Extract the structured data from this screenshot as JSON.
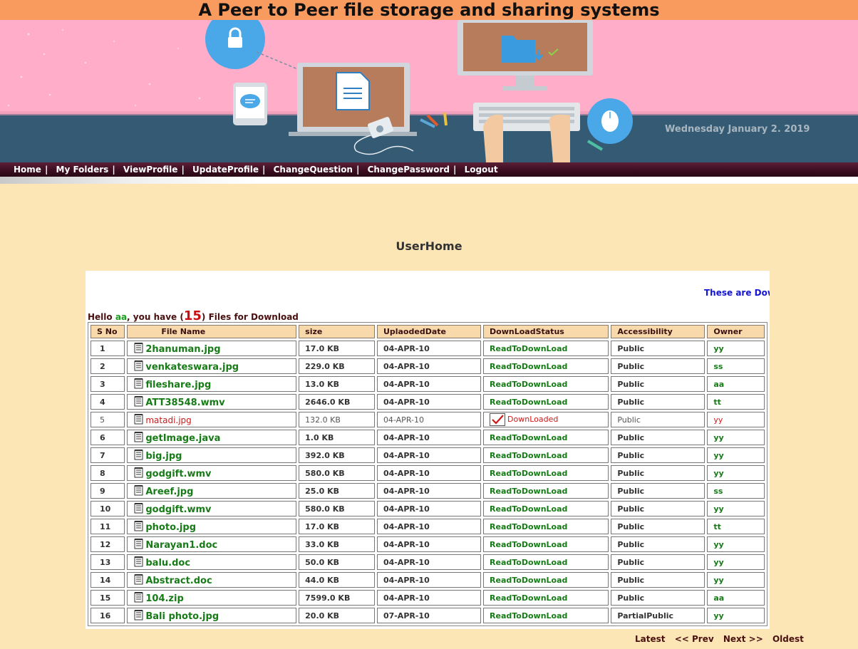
{
  "site_title": "A Peer to Peer file storage and sharing systems",
  "banner": {
    "date_text": "Wednesday January 2. 2019",
    "colors": {
      "wall": "#ffadc9",
      "desk": "#355a74",
      "screen": "#b77c5b"
    },
    "icons": [
      "lock-icon",
      "chat-icon",
      "document-icon",
      "folder-icon",
      "mouse-icon",
      "keyboard-icon",
      "music-player-icon"
    ]
  },
  "nav": {
    "items": [
      {
        "label": "Home"
      },
      {
        "label": "My Folders"
      },
      {
        "label": "ViewProfile"
      },
      {
        "label": "UpdateProfile"
      },
      {
        "label": "ChangeQuestion"
      },
      {
        "label": "ChangePassword"
      },
      {
        "label": "Logout"
      }
    ],
    "separator": "|"
  },
  "page_heading": "UserHome",
  "marquee_text": "These are Dow",
  "greeting": {
    "prefix": "Hello ",
    "username": "aa",
    "middle": ", you have (",
    "count": "15",
    "suffix": ") Files for Download"
  },
  "table": {
    "headers": {
      "sno": "S No",
      "file_name": "File Name",
      "size": "size",
      "date": "UplaodedDate",
      "status": "DownLoadStatus",
      "access": "Accessibility",
      "owner": "Owner"
    },
    "rows": [
      {
        "sno": "1",
        "name": "2hanuman.jpg",
        "size": "17.0 KB",
        "date": "04-APR-10",
        "status": "ReadToDownLoad",
        "access": "Public",
        "owner": "yy",
        "downloaded": false
      },
      {
        "sno": "2",
        "name": "venkateswara.jpg",
        "size": "229.0 KB",
        "date": "04-APR-10",
        "status": "ReadToDownLoad",
        "access": "Public",
        "owner": "ss",
        "downloaded": false
      },
      {
        "sno": "3",
        "name": "fileshare.jpg",
        "size": "13.0 KB",
        "date": "04-APR-10",
        "status": "ReadToDownLoad",
        "access": "Public",
        "owner": "aa",
        "downloaded": false
      },
      {
        "sno": "4",
        "name": "ATT38548.wmv",
        "size": "2646.0 KB",
        "date": "04-APR-10",
        "status": "ReadToDownLoad",
        "access": "Public",
        "owner": "tt",
        "downloaded": false
      },
      {
        "sno": "5",
        "name": "matadi.jpg",
        "size": "132.0 KB",
        "date": "04-APR-10",
        "status": "DownLoaded",
        "access": "Public",
        "owner": "yy",
        "downloaded": true
      },
      {
        "sno": "6",
        "name": "getImage.java",
        "size": "1.0 KB",
        "date": "04-APR-10",
        "status": "ReadToDownLoad",
        "access": "Public",
        "owner": "yy",
        "downloaded": false
      },
      {
        "sno": "7",
        "name": "big.jpg",
        "size": "392.0 KB",
        "date": "04-APR-10",
        "status": "ReadToDownLoad",
        "access": "Public",
        "owner": "yy",
        "downloaded": false
      },
      {
        "sno": "8",
        "name": "godgift.wmv",
        "size": "580.0 KB",
        "date": "04-APR-10",
        "status": "ReadToDownLoad",
        "access": "Public",
        "owner": "yy",
        "downloaded": false
      },
      {
        "sno": "9",
        "name": "Areef.jpg",
        "size": "25.0 KB",
        "date": "04-APR-10",
        "status": "ReadToDownLoad",
        "access": "Public",
        "owner": "ss",
        "downloaded": false
      },
      {
        "sno": "10",
        "name": "godgift.wmv",
        "size": "580.0 KB",
        "date": "04-APR-10",
        "status": "ReadToDownLoad",
        "access": "Public",
        "owner": "yy",
        "downloaded": false
      },
      {
        "sno": "11",
        "name": "photo.jpg",
        "size": "17.0 KB",
        "date": "04-APR-10",
        "status": "ReadToDownLoad",
        "access": "Public",
        "owner": "tt",
        "downloaded": false
      },
      {
        "sno": "12",
        "name": "Narayan1.doc",
        "size": "33.0 KB",
        "date": "04-APR-10",
        "status": "ReadToDownLoad",
        "access": "Public",
        "owner": "yy",
        "downloaded": false
      },
      {
        "sno": "13",
        "name": "balu.doc",
        "size": "50.0 KB",
        "date": "04-APR-10",
        "status": "ReadToDownLoad",
        "access": "Public",
        "owner": "yy",
        "downloaded": false
      },
      {
        "sno": "14",
        "name": "Abstract.doc",
        "size": "44.0 KB",
        "date": "04-APR-10",
        "status": "ReadToDownLoad",
        "access": "Public",
        "owner": "yy",
        "downloaded": false
      },
      {
        "sno": "15",
        "name": "104.zip",
        "size": "7599.0 KB",
        "date": "04-APR-10",
        "status": "ReadToDownLoad",
        "access": "Public",
        "owner": "aa",
        "downloaded": false
      },
      {
        "sno": "16",
        "name": "Bali photo.jpg",
        "size": "20.0 KB",
        "date": "07-APR-10",
        "status": "ReadToDownLoad",
        "access": "PartialPublic",
        "owner": "yy",
        "downloaded": false
      }
    ]
  },
  "pager": {
    "latest": "Latest",
    "prev": "<< Prev",
    "next": "Next >>",
    "oldest": "Oldest"
  }
}
